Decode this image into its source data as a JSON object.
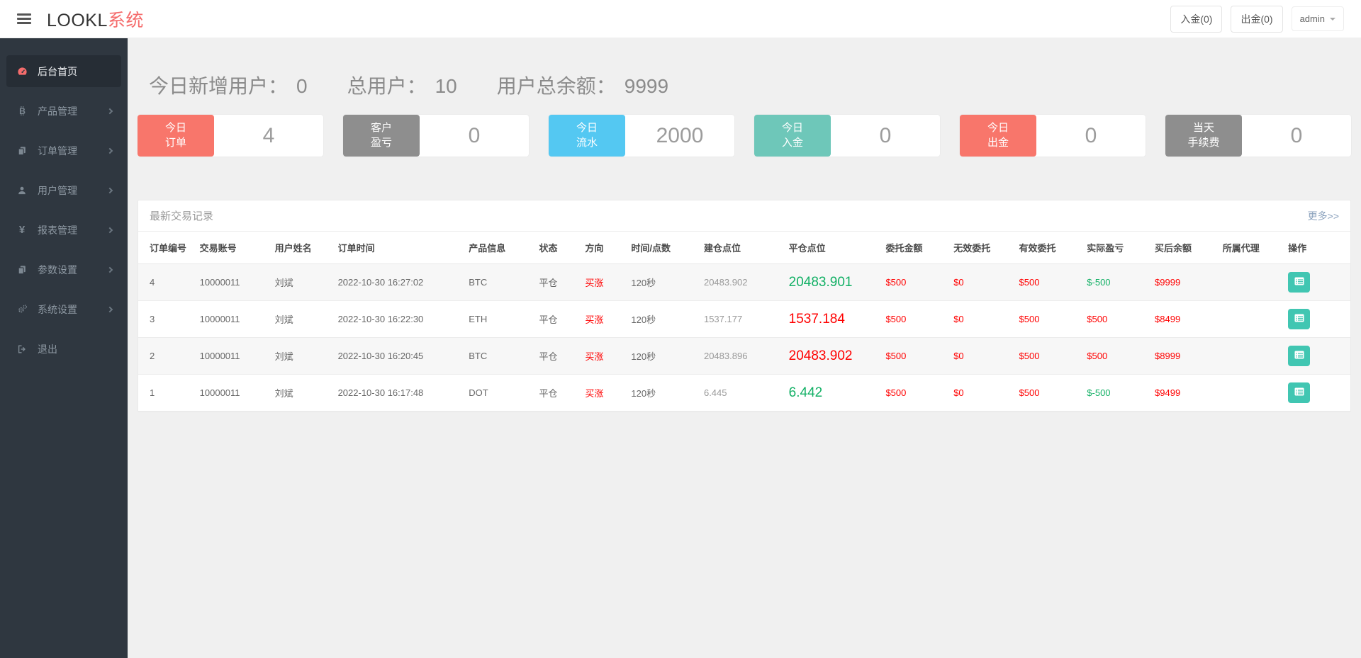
{
  "header": {
    "logo_black": "LOOKL",
    "logo_red": "系统",
    "deposit_btn": "入金(0)",
    "withdraw_btn": "出金(0)",
    "user_menu": "admin"
  },
  "sidebar": {
    "items": [
      {
        "id": "home",
        "label": "后台首页",
        "icon": "dashboard-icon",
        "active": true,
        "arrow": false
      },
      {
        "id": "products",
        "label": "产品管理",
        "icon": "bitcoin-icon",
        "active": false,
        "arrow": true
      },
      {
        "id": "orders",
        "label": "订单管理",
        "icon": "copy-icon",
        "active": false,
        "arrow": true
      },
      {
        "id": "users",
        "label": "用户管理",
        "icon": "user-icon",
        "active": false,
        "arrow": true
      },
      {
        "id": "reports",
        "label": "报表管理",
        "icon": "yen-icon",
        "active": false,
        "arrow": true
      },
      {
        "id": "params",
        "label": "参数设置",
        "icon": "copy-icon",
        "active": false,
        "arrow": true
      },
      {
        "id": "system",
        "label": "系统设置",
        "icon": "gears-icon",
        "active": false,
        "arrow": true
      },
      {
        "id": "logout",
        "label": "退出",
        "icon": "signout-icon",
        "active": false,
        "arrow": false
      }
    ]
  },
  "stats": [
    {
      "id": "new-users-today",
      "label": "今日新增用户：",
      "value": "0"
    },
    {
      "id": "total-users",
      "label": "总用户：",
      "value": "10"
    },
    {
      "id": "total-balance",
      "label": "用户总余额：",
      "value": "9999"
    }
  ],
  "cards": [
    {
      "id": "today-orders",
      "label": "今日\n订单",
      "value": "4",
      "color": "#f8766b"
    },
    {
      "id": "customer-pnl",
      "label": "客户\n盈亏",
      "value": "0",
      "color": "#8e8e8e"
    },
    {
      "id": "today-flow",
      "label": "今日\n流水",
      "value": "2000",
      "color": "#54c8f2"
    },
    {
      "id": "today-deposit",
      "label": "今日\n入金",
      "value": "0",
      "color": "#6ec7b9"
    },
    {
      "id": "today-withdraw",
      "label": "今日\n出金",
      "value": "0",
      "color": "#f8766b"
    },
    {
      "id": "today-fee",
      "label": "当天\n手续费",
      "value": "0",
      "color": "#8e8e8e"
    }
  ],
  "panel": {
    "title": "最新交易记录",
    "more": "更多>>"
  },
  "table": {
    "headers": [
      "订单编号",
      "交易账号",
      "用户姓名",
      "订单时间",
      "产品信息",
      "状态",
      "方向",
      "时间/点数",
      "建仓点位",
      "平仓点位",
      "委托金额",
      "无效委托",
      "有效委托",
      "实际盈亏",
      "买后余额",
      "所属代理",
      "操作"
    ],
    "rows": [
      {
        "cells": [
          [
            "4",
            ""
          ],
          [
            "10000011",
            ""
          ],
          [
            "刘斌",
            ""
          ],
          [
            "2022-10-30 16:27:02",
            ""
          ],
          [
            "BTC",
            ""
          ],
          [
            "平仓",
            ""
          ],
          [
            "买涨",
            "red"
          ],
          [
            "120秒",
            ""
          ],
          [
            "20483.902",
            "muted"
          ],
          [
            "20483.901",
            "big green"
          ],
          [
            "$500",
            "red"
          ],
          [
            "$0",
            "red"
          ],
          [
            "$500",
            "red"
          ],
          [
            "$-500",
            "green"
          ],
          [
            "$9999",
            "red"
          ],
          [
            "",
            ""
          ],
          [
            "",
            "action"
          ]
        ]
      },
      {
        "cells": [
          [
            "3",
            ""
          ],
          [
            "10000011",
            ""
          ],
          [
            "刘斌",
            ""
          ],
          [
            "2022-10-30 16:22:30",
            ""
          ],
          [
            "ETH",
            ""
          ],
          [
            "平仓",
            ""
          ],
          [
            "买涨",
            "red"
          ],
          [
            "120秒",
            ""
          ],
          [
            "1537.177",
            "muted"
          ],
          [
            "1537.184",
            "big red"
          ],
          [
            "$500",
            "red"
          ],
          [
            "$0",
            "red"
          ],
          [
            "$500",
            "red"
          ],
          [
            "$500",
            "red"
          ],
          [
            "$8499",
            "red"
          ],
          [
            "",
            ""
          ],
          [
            "",
            "action"
          ]
        ]
      },
      {
        "cells": [
          [
            "2",
            ""
          ],
          [
            "10000011",
            ""
          ],
          [
            "刘斌",
            ""
          ],
          [
            "2022-10-30 16:20:45",
            ""
          ],
          [
            "BTC",
            ""
          ],
          [
            "平仓",
            ""
          ],
          [
            "买涨",
            "red"
          ],
          [
            "120秒",
            ""
          ],
          [
            "20483.896",
            "muted"
          ],
          [
            "20483.902",
            "big red"
          ],
          [
            "$500",
            "red"
          ],
          [
            "$0",
            "red"
          ],
          [
            "$500",
            "red"
          ],
          [
            "$500",
            "red"
          ],
          [
            "$8999",
            "red"
          ],
          [
            "",
            ""
          ],
          [
            "",
            "action"
          ]
        ]
      },
      {
        "cells": [
          [
            "1",
            ""
          ],
          [
            "10000011",
            ""
          ],
          [
            "刘斌",
            ""
          ],
          [
            "2022-10-30 16:17:48",
            ""
          ],
          [
            "DOT",
            ""
          ],
          [
            "平仓",
            ""
          ],
          [
            "买涨",
            "red"
          ],
          [
            "120秒",
            ""
          ],
          [
            "6.445",
            "muted"
          ],
          [
            "6.442",
            "big green"
          ],
          [
            "$500",
            "red"
          ],
          [
            "$0",
            "red"
          ],
          [
            "$500",
            "red"
          ],
          [
            "$-500",
            "green"
          ],
          [
            "$9499",
            "red"
          ],
          [
            "",
            ""
          ],
          [
            "",
            "action"
          ]
        ]
      }
    ]
  },
  "colors": {
    "brand_red": "#f56c6c",
    "sidebar_bg": "#2f3740",
    "table_red": "#ff0000",
    "table_green": "#12b065",
    "action_teal": "#41c6b2"
  }
}
